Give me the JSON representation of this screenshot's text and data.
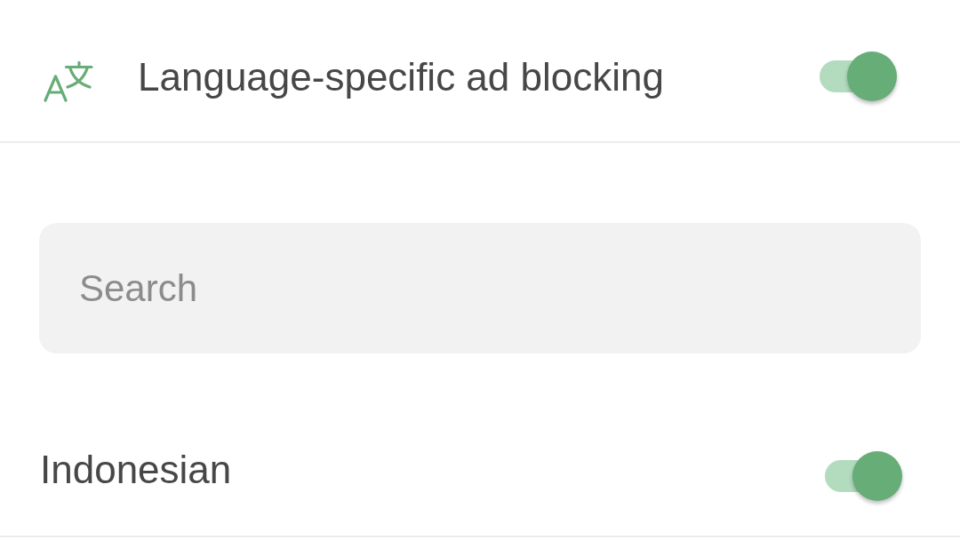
{
  "header": {
    "title": "Language-specific ad blocking",
    "enabled": true
  },
  "search": {
    "placeholder": "Search"
  },
  "languages": [
    {
      "name": "Indonesian",
      "enabled": true
    }
  ]
}
